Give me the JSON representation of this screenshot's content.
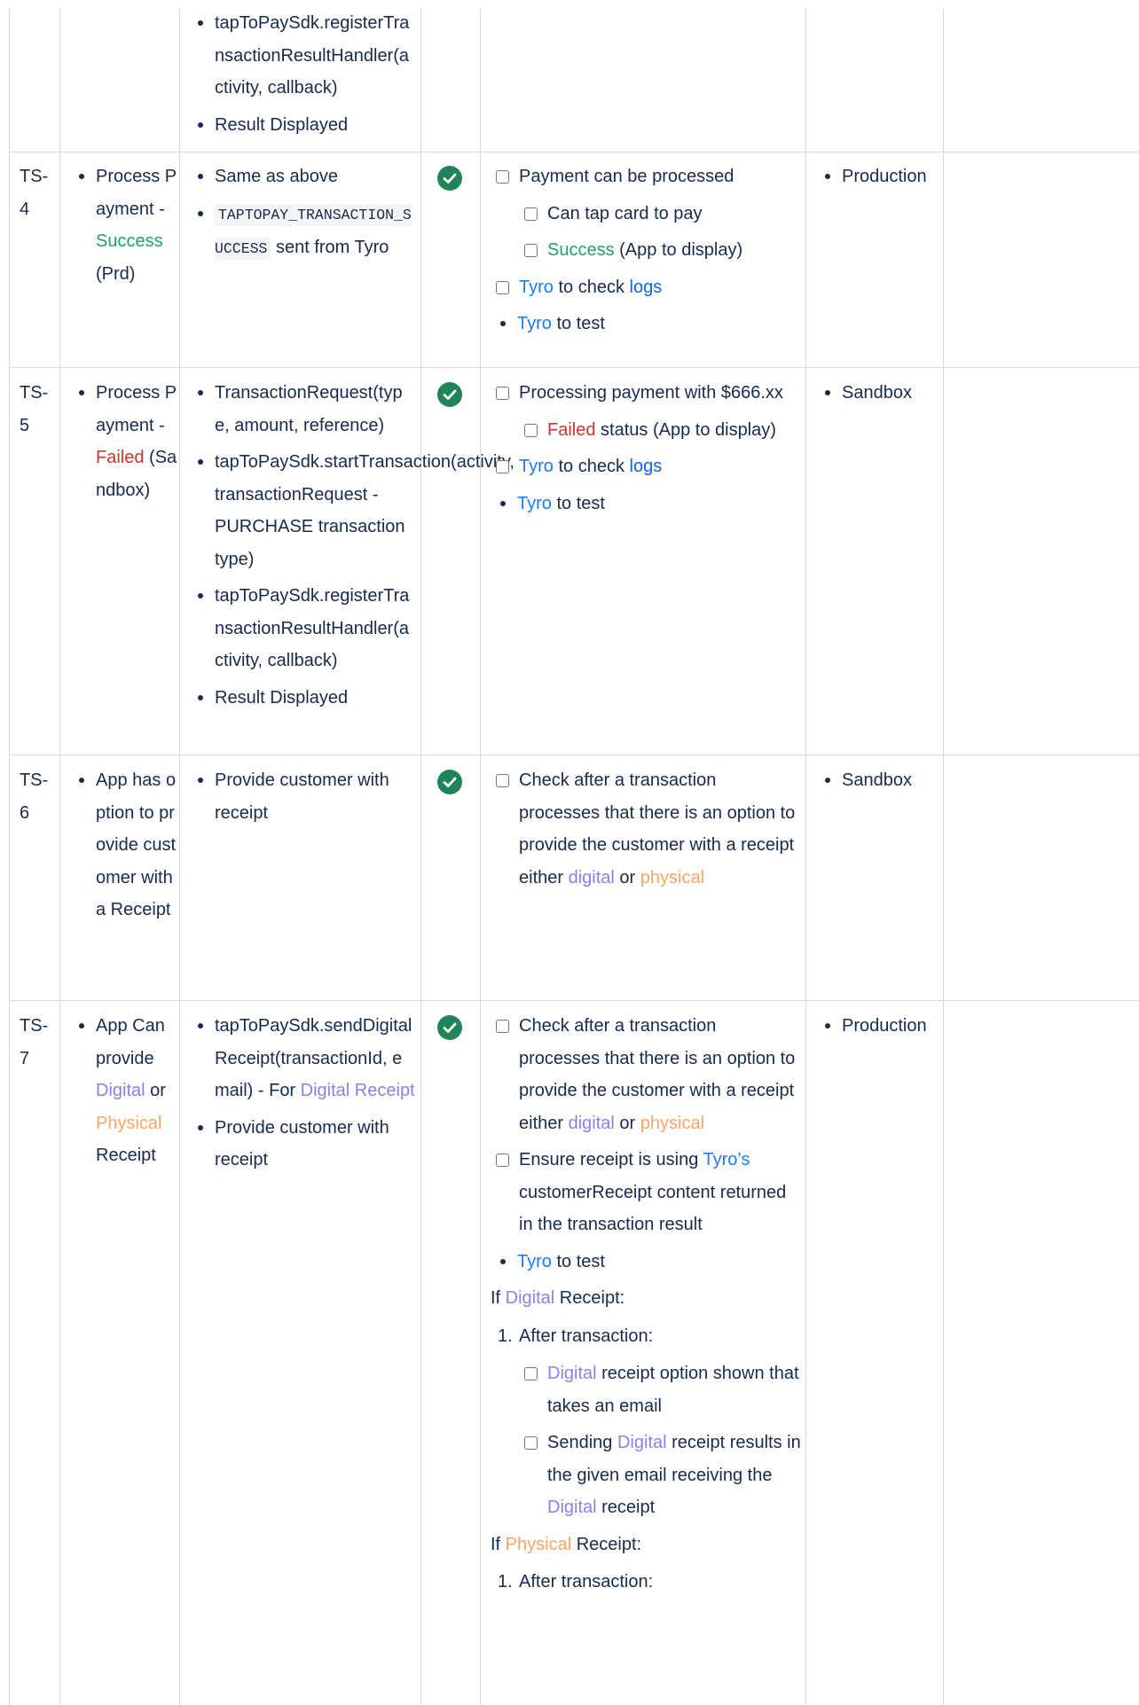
{
  "row_top": {
    "steps": [
      "tapToPaySdk.registerTransactionResultHandler(activity, callback)",
      "Result Displayed"
    ]
  },
  "ts4": {
    "id": "TS-4",
    "scenario": {
      "pre": "Process Payment - ",
      "status": "Success",
      "post": " (Prd)"
    },
    "steps": {
      "s1": "Same as above",
      "code": "TAPTOPAY_TRANSACTION_SUCCESS",
      "s2_post": " sent from Tyro"
    },
    "checks": {
      "c1": "Payment can be processed",
      "c1a": "Can tap card to pay",
      "c1b_status": "Success",
      "c1b_post": " (App to display)",
      "c2_tyro": "Tyro",
      "c2_mid": " to check ",
      "c2_link": "logs",
      "c3_tyro": "Tyro",
      "c3_post": " to test"
    },
    "env": "Production"
  },
  "ts5": {
    "id": "TS-5",
    "scenario": {
      "pre": "Process Payment - ",
      "status": "Failed",
      "post": " (Sandbox)"
    },
    "steps": [
      "TransactionRequest(type, amount, reference)",
      "tapToPaySdk.startTransaction(activity, transactionRequest - PURCHASE transaction type)",
      "tapToPaySdk.registerTransactionResultHandler(activity, callback)",
      "Result Displayed"
    ],
    "checks": {
      "c1": "Processing payment with $666.xx",
      "c1a_status": "Failed",
      "c1a_post": " status (App to display)",
      "c2_tyro": "Tyro",
      "c2_mid": " to check ",
      "c2_link": "logs",
      "c3_tyro": "Tyro",
      "c3_post": " to test"
    },
    "env": "Sandbox"
  },
  "ts6": {
    "id": "TS-6",
    "scenario": "App has option to provide customer with a Receipt",
    "steps": [
      "Provide customer with receipt"
    ],
    "checks": {
      "c1_pre": "Check after a transaction processes that there is an option to provide the customer with a receipt either ",
      "digital": "digital",
      "or": " or ",
      "physical": "physical"
    },
    "env": "Sandbox"
  },
  "ts7": {
    "id": "TS-7",
    "scenario": {
      "pre": "App Can provide ",
      "digital": "Digital",
      "or": " or ",
      "physical": "Physical",
      "post": " Receipt"
    },
    "steps": {
      "s1_pre": "tapToPaySdk.sendDigitalReceipt(transactionId, email) - For ",
      "s1_link": "Digital Receipt",
      "s2": "Provide customer with receipt"
    },
    "checks": {
      "c1_pre": "Check after a transaction processes that there is an option to provide the customer with a receipt either ",
      "digital": "digital",
      "or": " or ",
      "physical": "physical",
      "c2_pre": "Ensure receipt is using ",
      "c2_tyro": "Tyro’s",
      "c2_post": " customerReceipt content returned in the transaction result",
      "c3_tyro": "Tyro",
      "c3_post": " to test",
      "if_digital_pre": "If ",
      "if_digital_word": "Digital",
      "if_digital_post": " Receipt:",
      "ol1": "After transaction:",
      "d1_word": "Digital",
      "d1_post": " receipt option shown that takes an email",
      "d2_pre": "Sending ",
      "d2_word": "Digital",
      "d2_mid": " receipt results in the given email receiving the ",
      "d2_word2": "Digital",
      "d2_post": " receipt",
      "if_physical_pre": "If ",
      "if_physical_word": "Physical",
      "if_physical_post": " Receipt:",
      "ol2": "After transaction:"
    },
    "env": "Production"
  },
  "ol_number": "1.",
  "colors": {
    "success": "#22a06b",
    "failed": "#c9372c",
    "tyro": "#1d7afc",
    "link": "#0c66e4",
    "digital": "#8f7ee7",
    "physical": "#fea362",
    "check_icon": "#1f845a"
  },
  "icons": [
    "success-check-icon",
    "checkbox-icon"
  ]
}
